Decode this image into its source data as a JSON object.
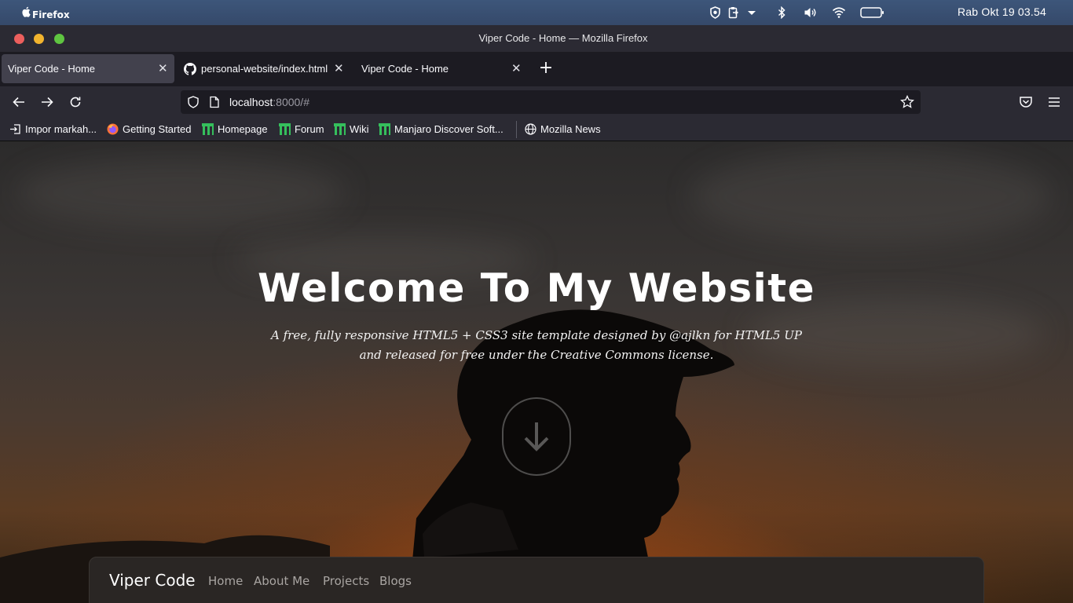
{
  "system_bar": {
    "app_name": "Firefox",
    "clock": "Rab  Okt  19 03.54",
    "tray_icons": [
      "shield-icon",
      "clipboard-icon",
      "dropdown-icon",
      "bluetooth-icon",
      "volume-icon",
      "wifi-icon",
      "battery-icon"
    ]
  },
  "window": {
    "title": "Viper Code - Home — Mozilla Firefox",
    "traffic_lights": {
      "close": "#ec5f5d",
      "minimize": "#f2b42e",
      "maximize": "#5fc541"
    }
  },
  "tabs": [
    {
      "label": "Viper Code - Home",
      "active": true
    },
    {
      "label": "personal-website/index.html",
      "active": false
    },
    {
      "label": "Viper Code - Home",
      "active": false
    }
  ],
  "urlbar": {
    "host": "localhost",
    "rest": ":8000/#"
  },
  "bookmarks": [
    {
      "label": "Impor markah...",
      "icon": "import-icon"
    },
    {
      "label": "Getting Started",
      "icon": "firefox-icon"
    },
    {
      "label": "Homepage",
      "icon": "manjaro-icon"
    },
    {
      "label": "Forum",
      "icon": "manjaro-icon"
    },
    {
      "label": "Wiki",
      "icon": "manjaro-icon"
    },
    {
      "label": "Manjaro Discover Soft...",
      "icon": "manjaro-icon"
    },
    {
      "label": "Mozilla News",
      "icon": "globe-icon"
    }
  ],
  "hero": {
    "title": "Welcome To My Website",
    "subtitle": "A free, fully responsive HTML5 + CSS3 site template designed by @ajlkn for HTML5 UP and released for free under the Creative Commons license."
  },
  "site_nav": {
    "brand": "Viper Code",
    "links": [
      "Home",
      "About Me",
      "Projects",
      "Blogs"
    ]
  },
  "colors": {
    "accent_manjaro": "#35bf5c",
    "browser_chrome": "#2b2a33",
    "tab_active": "#42414d"
  }
}
